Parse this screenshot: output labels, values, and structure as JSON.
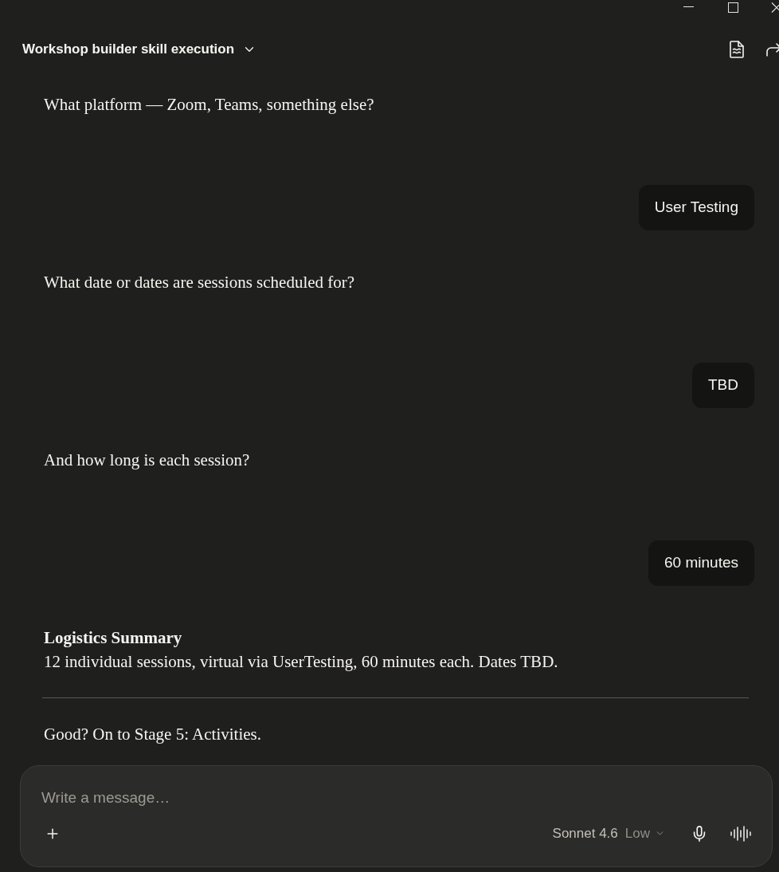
{
  "header": {
    "title": "Workshop builder skill execution"
  },
  "messages": [
    {
      "kind": "assistant",
      "text": "What platform — Zoom, Teams, something else?"
    },
    {
      "kind": "user",
      "text": "User Testing"
    },
    {
      "kind": "assistant",
      "text": "What date or dates are sessions scheduled for?"
    },
    {
      "kind": "user",
      "text": "TBD"
    },
    {
      "kind": "assistant",
      "text": "And how long is each session?"
    },
    {
      "kind": "user",
      "text": "60 minutes"
    },
    {
      "kind": "summary",
      "heading": "Logistics Summary",
      "text": "12 individual sessions, virtual via UserTesting, 60 minutes each. Dates TBD."
    },
    {
      "kind": "divider"
    },
    {
      "kind": "assistant",
      "text": "Good? On to Stage 5: Activities."
    }
  ],
  "composer": {
    "placeholder": "Write a message…",
    "model": "Sonnet 4.6",
    "effort": "Low"
  }
}
